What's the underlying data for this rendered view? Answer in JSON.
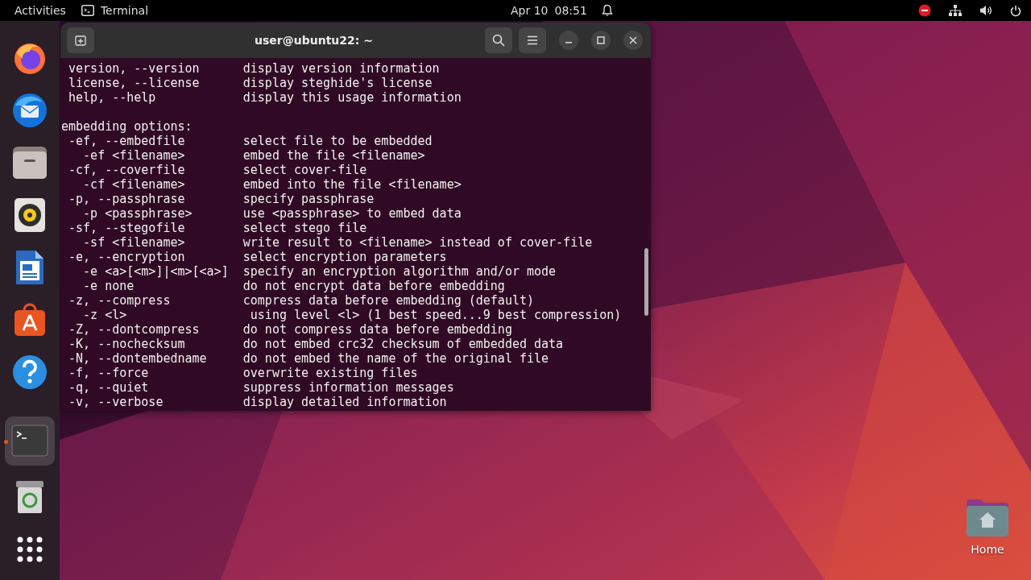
{
  "top_bar": {
    "activities": "Activities",
    "app": "Terminal",
    "date": "Apr 10",
    "time": "08:51"
  },
  "dock": {
    "items": [
      {
        "kind": "firefox",
        "selected": false
      },
      {
        "kind": "mail",
        "selected": false
      },
      {
        "kind": "files",
        "selected": false
      },
      {
        "kind": "music",
        "selected": false
      },
      {
        "kind": "writer",
        "selected": false
      },
      {
        "kind": "store",
        "selected": false
      },
      {
        "kind": "help",
        "selected": false
      },
      {
        "kind": "terminal",
        "selected": true
      },
      {
        "kind": "trash",
        "selected": false
      },
      {
        "kind": "apps",
        "selected": false
      }
    ]
  },
  "window": {
    "title": "user@ubuntu22: ~",
    "blocks": [
      {
        "lines": [
          " version, --version      display version information",
          " license, --license      display steghide's license",
          " help, --help            display this usage information"
        ]
      },
      {
        "lines": [
          "embedding options:",
          " -ef, --embedfile        select file to be embedded",
          "   -ef <filename>        embed the file <filename>",
          " -cf, --coverfile        select cover-file",
          "   -cf <filename>        embed into the file <filename>",
          " -p, --passphrase        specify passphrase",
          "   -p <passphrase>       use <passphrase> to embed data",
          " -sf, --stegofile        select stego file",
          "   -sf <filename>        write result to <filename> instead of cover-file",
          " -e, --encryption        select encryption parameters",
          "   -e <a>[<m>]|<m>[<a>]  specify an encryption algorithm and/or mode",
          "   -e none               do not encrypt data before embedding",
          " -z, --compress          compress data before embedding (default)",
          "   -z <l>                 using level <l> (1 best speed...9 best compression)",
          " -Z, --dontcompress      do not compress data before embedding",
          " -K, --nochecksum        do not embed crc32 checksum of embedded data",
          " -N, --dontembedname     do not embed the name of the original file",
          " -f, --force             overwrite existing files",
          " -q, --quiet             suppress information messages",
          " -v, --verbose           display detailed information"
        ]
      }
    ]
  },
  "desktop": {
    "icons": [
      {
        "label": "Home"
      }
    ]
  }
}
